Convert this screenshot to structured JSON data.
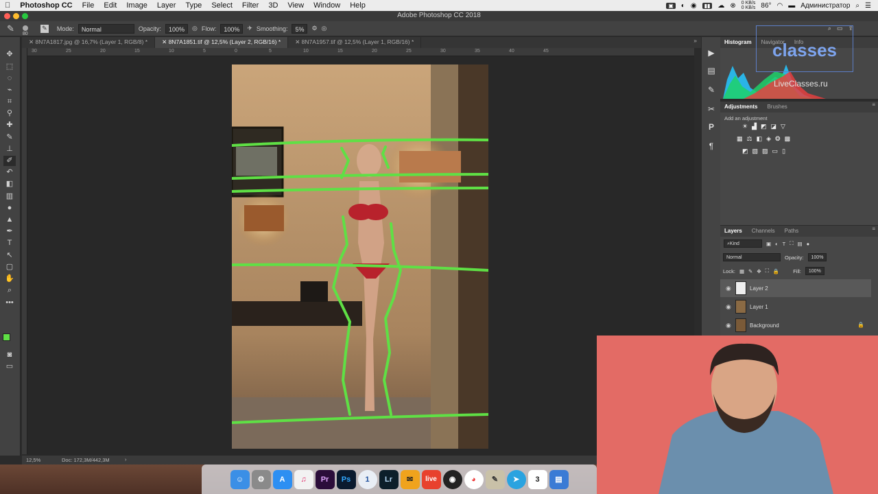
{
  "menubar": {
    "apple": "",
    "app_name": "Photoshop CC",
    "items": [
      "File",
      "Edit",
      "Image",
      "Layer",
      "Type",
      "Select",
      "Filter",
      "3D",
      "View",
      "Window",
      "Help"
    ],
    "status_right": {
      "net_up": "0 KB/s",
      "net_down": "0 KB/s",
      "temp": "86°",
      "user": "Администратор"
    }
  },
  "window": {
    "title": "Adobe Photoshop CC 2018"
  },
  "options": {
    "brush_size": "80",
    "mode_label": "Mode:",
    "mode_value": "Normal",
    "opacity_label": "Opacity:",
    "opacity_value": "100%",
    "flow_label": "Flow:",
    "flow_value": "100%",
    "smoothing_label": "Smoothing:",
    "smoothing_value": "5%"
  },
  "tabs": [
    {
      "label": "8N7A1817.jpg @ 16,7% (Layer 1, RGB/8) *",
      "active": false
    },
    {
      "label": "8N7A1851.tif @ 12,5% (Layer 2, RGB/16) *",
      "active": true
    },
    {
      "label": "8N7A1957.tif @ 12,5% (Layer 1, RGB/16) *",
      "active": false
    }
  ],
  "ruler_ticks": [
    "30",
    "25",
    "20",
    "15",
    "10",
    "5",
    "0",
    "5",
    "10",
    "15",
    "20",
    "25",
    "30",
    "35",
    "40",
    "45"
  ],
  "status": {
    "zoom": "12,5%",
    "doc": "Doc: 172,3M/442,3M"
  },
  "histogram_panel": {
    "tabs": [
      "Histogram",
      "Navigator",
      "Info"
    ]
  },
  "adjustments_panel": {
    "tabs": [
      "Adjustments",
      "Brushes"
    ],
    "hint": "Add an adjustment"
  },
  "layers_panel": {
    "tabs": [
      "Layers",
      "Channels",
      "Paths"
    ],
    "filter_label": "Kind",
    "blend_mode": "Normal",
    "opacity_label": "Opacity:",
    "opacity_value": "100%",
    "lock_label": "Lock:",
    "fill_label": "Fill:",
    "fill_value": "100%",
    "layers": [
      {
        "name": "Layer 2",
        "selected": true,
        "locked": false
      },
      {
        "name": "Layer 1",
        "selected": false,
        "locked": false
      },
      {
        "name": "Background",
        "selected": false,
        "locked": true
      }
    ]
  },
  "watermark": {
    "brand": "classes",
    "site": "LiveClasses.ru"
  },
  "dock": {
    "icons": [
      "Finder",
      "System Preferences",
      "App Store",
      "iTunes",
      "Pr",
      "Ps",
      "1",
      "Lr",
      "Gmail",
      "live",
      "Camera",
      "Chrome",
      "Preview",
      "Telegram",
      "3",
      "Keynote"
    ],
    "calendar_day": "3"
  },
  "colors": {
    "accent_green": "#5fe045",
    "menubar": "#ececec",
    "panel": "#474747",
    "webcam_bg": "#e36b65"
  }
}
